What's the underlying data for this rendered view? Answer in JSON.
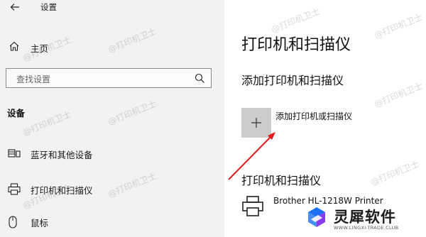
{
  "window": {
    "title": "设置"
  },
  "sidebar": {
    "home_label": "主页",
    "search_placeholder": "查找设置",
    "section_heading": "设备",
    "items": [
      {
        "label": "蓝牙和其他设备",
        "icon": "devices-icon"
      },
      {
        "label": "打印机和扫描仪",
        "icon": "printer-icon"
      },
      {
        "label": "鼠标",
        "icon": "mouse-icon"
      }
    ]
  },
  "main": {
    "title": "打印机和扫描仪",
    "add_heading": "添加打印机和扫描仪",
    "add_button_label": "添加打印机或扫描仪",
    "printers_heading": "打印机和扫描仪",
    "printers": [
      {
        "name": "Brother HL-1218W Printer"
      }
    ]
  },
  "watermark_text": "@打印机卫士",
  "brand": {
    "name": "灵犀软件",
    "site": "WWW.LINGXI-TRADE.CLUB"
  },
  "colors": {
    "sidebar_bg": "#f2f2f2",
    "add_tile_bg": "#cccccc",
    "arrow": "#e01b1b",
    "brand_blue": "#1e6ff2",
    "brand_purple": "#8a3cf0"
  }
}
